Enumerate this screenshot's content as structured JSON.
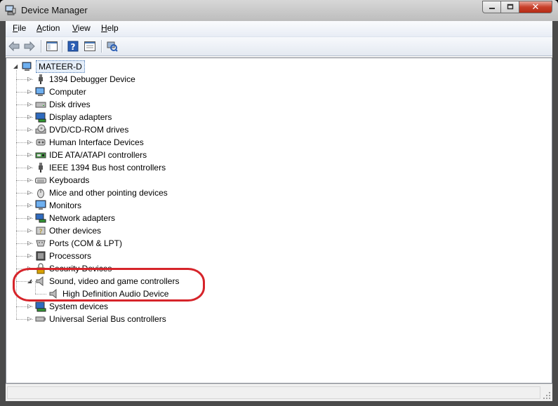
{
  "window": {
    "title": "Device Manager",
    "close_glyph": "✕"
  },
  "menu": [
    {
      "label": "File",
      "accel": "F"
    },
    {
      "label": "Action",
      "accel": "A"
    },
    {
      "label": "View",
      "accel": "V"
    },
    {
      "label": "Help",
      "accel": "H"
    }
  ],
  "toolbar": [
    "back-icon",
    "forward-icon",
    "show-hide-console-tree-icon",
    "help-icon",
    "properties-icon",
    "scan-hardware-changes-icon"
  ],
  "tree": {
    "root": "MATEER-D",
    "categories": [
      {
        "label": "1394 Debugger Device",
        "icon": "usb-plug-icon"
      },
      {
        "label": "Computer",
        "icon": "computer-icon"
      },
      {
        "label": "Disk drives",
        "icon": "disk-drive-icon"
      },
      {
        "label": "Display adapters",
        "icon": "display-adapter-icon"
      },
      {
        "label": "DVD/CD-ROM drives",
        "icon": "dvd-drive-icon"
      },
      {
        "label": "Human Interface Devices",
        "icon": "hid-icon"
      },
      {
        "label": "IDE ATA/ATAPI controllers",
        "icon": "ide-controller-icon"
      },
      {
        "label": "IEEE 1394 Bus host controllers",
        "icon": "usb-plug-icon"
      },
      {
        "label": "Keyboards",
        "icon": "keyboard-icon"
      },
      {
        "label": "Mice and other pointing devices",
        "icon": "mouse-icon"
      },
      {
        "label": "Monitors",
        "icon": "monitor-icon"
      },
      {
        "label": "Network adapters",
        "icon": "network-adapter-icon"
      },
      {
        "label": "Other devices",
        "icon": "other-devices-icon"
      },
      {
        "label": "Ports (COM & LPT)",
        "icon": "port-icon"
      },
      {
        "label": "Processors",
        "icon": "processor-icon"
      },
      {
        "label": "Security Devices",
        "icon": "security-icon"
      },
      {
        "label": "Sound, video and game controllers",
        "icon": "speaker-icon",
        "expanded": true,
        "children": [
          "High Definition Audio Device"
        ]
      },
      {
        "label": "System devices",
        "icon": "system-devices-icon"
      },
      {
        "label": "Universal Serial Bus controllers",
        "icon": "usb-icon"
      }
    ]
  },
  "colors": {
    "highlight": "#d6242a",
    "selection": "#e5eef9"
  }
}
